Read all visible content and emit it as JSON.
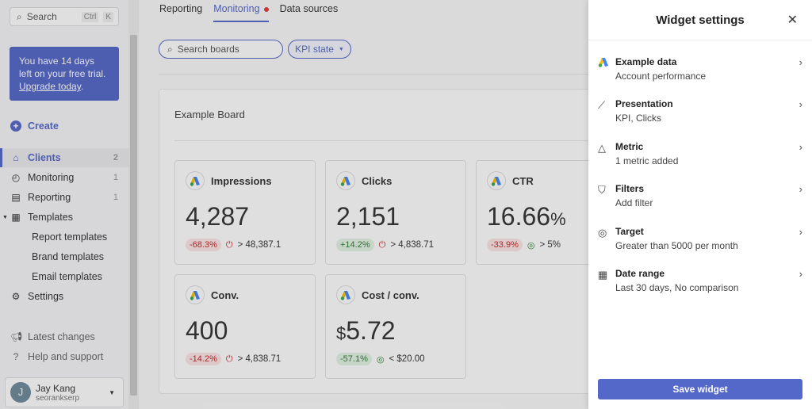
{
  "sidebar": {
    "search_label": "Search",
    "kbd1": "Ctrl",
    "kbd2": "K",
    "trial_text": "You have 14 days left on your free trial.",
    "trial_link": "Upgrade today",
    "trial_end": ".",
    "create": "Create",
    "items": [
      {
        "label": "Clients",
        "count": "2"
      },
      {
        "label": "Monitoring",
        "count": "1"
      },
      {
        "label": "Reporting",
        "count": "1"
      },
      {
        "label": "Templates"
      },
      {
        "label": "Report templates"
      },
      {
        "label": "Brand templates"
      },
      {
        "label": "Email templates"
      },
      {
        "label": "Settings"
      },
      {
        "label": "Latest changes"
      },
      {
        "label": "Help and support"
      }
    ],
    "user": {
      "initial": "J",
      "name": "Jay Kang",
      "org": "seorankserp"
    }
  },
  "main": {
    "tabs": [
      "Reporting",
      "Monitoring",
      "Data sources"
    ],
    "search_placeholder": "Search boards",
    "kpi_filter": "KPI state",
    "board_title": "Example Board",
    "cards": [
      {
        "title": "Impressions",
        "prefix": "",
        "value": "4,287",
        "suffix": "",
        "change": "-68.3%",
        "change_type": "neg",
        "target_status": "missed",
        "target": "> 48,387.1"
      },
      {
        "title": "Clicks",
        "prefix": "",
        "value": "2,151",
        "suffix": "",
        "change": "+14.2%",
        "change_type": "pos",
        "target_status": "missed",
        "target": "> 4,838.71"
      },
      {
        "title": "CTR",
        "prefix": "",
        "value": "16.66",
        "suffix": "%",
        "change": "-33.9%",
        "change_type": "neg",
        "target_status": "met",
        "target": "> 5%"
      },
      {
        "title": "Conv.",
        "prefix": "",
        "value": "400",
        "suffix": "",
        "change": "-14.2%",
        "change_type": "neg",
        "target_status": "missed",
        "target": "> 4,838.71"
      },
      {
        "title": "Cost / conv.",
        "prefix": "$",
        "value": "5.72",
        "suffix": "",
        "change": "-57.1%",
        "change_type": "pos",
        "target_status": "met",
        "target": "< $20.00"
      }
    ]
  },
  "panel": {
    "title": "Widget settings",
    "save": "Save widget",
    "items": [
      {
        "title": "Example data",
        "sub": "Account performance"
      },
      {
        "title": "Presentation",
        "sub": "KPI, Clicks"
      },
      {
        "title": "Metric",
        "sub": "1 metric added"
      },
      {
        "title": "Filters",
        "sub": "Add filter"
      },
      {
        "title": "Target",
        "sub": "Greater than 5000 per month"
      },
      {
        "title": "Date range",
        "sub": "Last 30 days, No comparison"
      }
    ]
  },
  "colors": {
    "accent": "#5468c9",
    "negative": "#c62828",
    "positive": "#2e7d32"
  }
}
